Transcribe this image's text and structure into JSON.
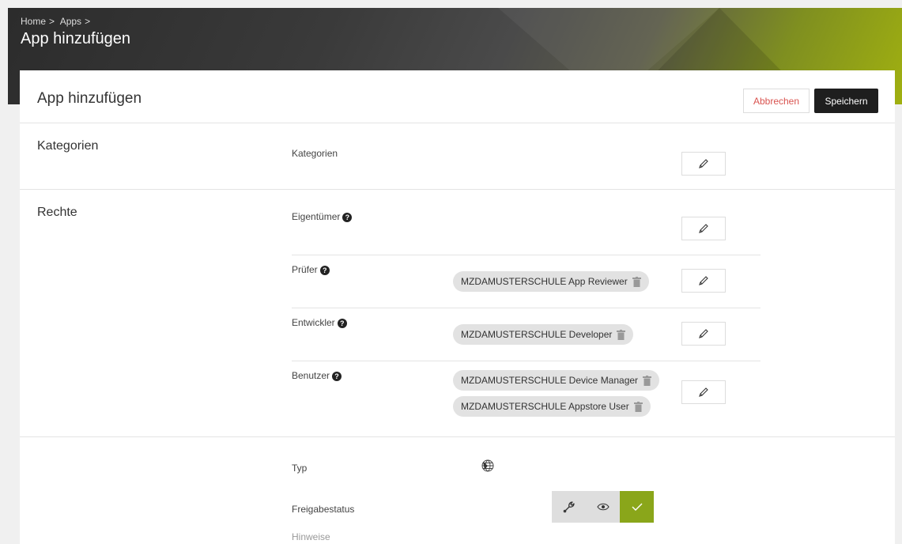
{
  "header": {
    "breadcrumb": [
      "Home",
      ">",
      "Apps",
      ">"
    ],
    "title": "App hinzufügen"
  },
  "card": {
    "title": "App hinzufügen",
    "cancel_label": "Abbrechen",
    "save_label": "Speichern"
  },
  "kategorien": {
    "section_title": "Kategorien",
    "field_label": "Kategorien"
  },
  "rechte": {
    "section_title": "Rechte",
    "eigentuemer_label": "Eigentümer",
    "pruefer_label": "Prüfer",
    "entwickler_label": "Entwickler",
    "benutzer_label": "Benutzer",
    "pruefer_groups": [
      "MZDAMUSTERSCHULE App Reviewer"
    ],
    "entwickler_groups": [
      "MZDAMUSTERSCHULE Developer"
    ],
    "benutzer_groups": [
      "MZDAMUSTERSCHULE Device Manager",
      "MZDAMUSTERSCHULE Appstore User"
    ]
  },
  "details": {
    "typ_label": "Typ",
    "typ_icon": "globe-icon",
    "freigabe_label": "Freigabestatus",
    "hinweise_label": "Hinweise",
    "status_options": [
      "wrench-icon",
      "eye-icon",
      "check-icon"
    ],
    "active_status": "check-icon"
  },
  "colors": {
    "accent": "#8aa61a",
    "danger": "#d9534f",
    "dark": "#1e1e1e"
  }
}
